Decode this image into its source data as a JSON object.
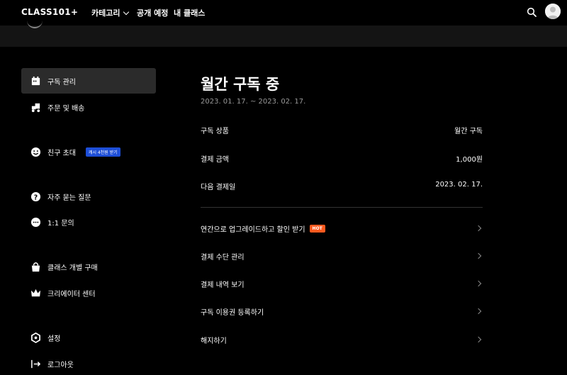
{
  "nav": {
    "logo": "CLASS101+",
    "items": [
      "카테고리",
      "공개 예정",
      "내 클래스"
    ]
  },
  "sidebar": {
    "items": [
      {
        "label": "구독 관리",
        "icon": "calendar-icon",
        "active": true
      },
      {
        "label": "주문 및 배송",
        "icon": "delivery-icon"
      },
      {
        "label": "친구 초대",
        "icon": "smile-icon",
        "badge": "캐시 4천원 받기"
      },
      {
        "label": "자주 묻는 질문",
        "icon": "question-icon"
      },
      {
        "label": "1:1 문의",
        "icon": "chat-icon"
      },
      {
        "label": "클래스 개별 구매",
        "icon": "shopping-bag-icon"
      },
      {
        "label": "크리에이터 센터",
        "icon": "crown-icon"
      },
      {
        "label": "설정",
        "icon": "settings-icon"
      },
      {
        "label": "로그아웃",
        "icon": "logout-icon"
      }
    ]
  },
  "main": {
    "title": "월간 구독 중",
    "period": "2023. 01. 17. ~ 2023. 02. 17.",
    "info": [
      {
        "label": "구독 상품",
        "value": "월간 구독"
      },
      {
        "label": "결제 금액",
        "value": "1,000원"
      },
      {
        "label": "다음 결제일",
        "value": "2023. 02. 17."
      }
    ],
    "menu": [
      {
        "label": "연간으로 업그레이드하고 할인 받기",
        "badge": "HOT"
      },
      {
        "label": "결제 수단 관리"
      },
      {
        "label": "결제 내역 보기"
      },
      {
        "label": "구독 이용권 등록하기"
      },
      {
        "label": "해지하기"
      }
    ]
  },
  "colors": {
    "background": "#000000",
    "active_item": "#2b2b2b",
    "badge_blue": "#1d4ed8",
    "hot_badge": "#ff5a1f"
  }
}
